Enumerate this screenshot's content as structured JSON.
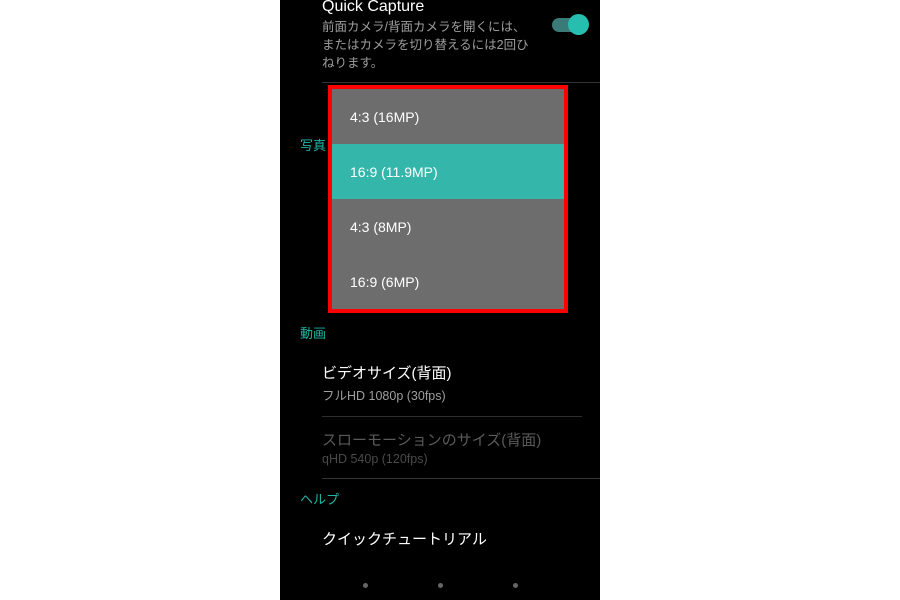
{
  "quickCapture": {
    "title": "Quick Capture",
    "subtitle": "前面カメラ/背面カメラを開くには、またはカメラを切り替えるには2回ひねります。",
    "toggle_on": true
  },
  "sections": {
    "photo": "写真",
    "video": "動画",
    "help": "ヘルプ"
  },
  "photoSizePopup": {
    "options": [
      {
        "label": "4:3 (16MP)",
        "selected": false
      },
      {
        "label": "16:9 (11.9MP)",
        "selected": true
      },
      {
        "label": "4:3 (8MP)",
        "selected": false
      },
      {
        "label": "16:9 (6MP)",
        "selected": false
      }
    ]
  },
  "videoSize": {
    "title": "ビデオサイズ(背面)",
    "subtitle": "フルHD 1080p (30fps)"
  },
  "slowMotion": {
    "title": "スローモーションのサイズ(背面)",
    "subtitle": "qHD 540p (120fps)"
  },
  "helpItem": {
    "title": "クイックチュートリアル"
  }
}
